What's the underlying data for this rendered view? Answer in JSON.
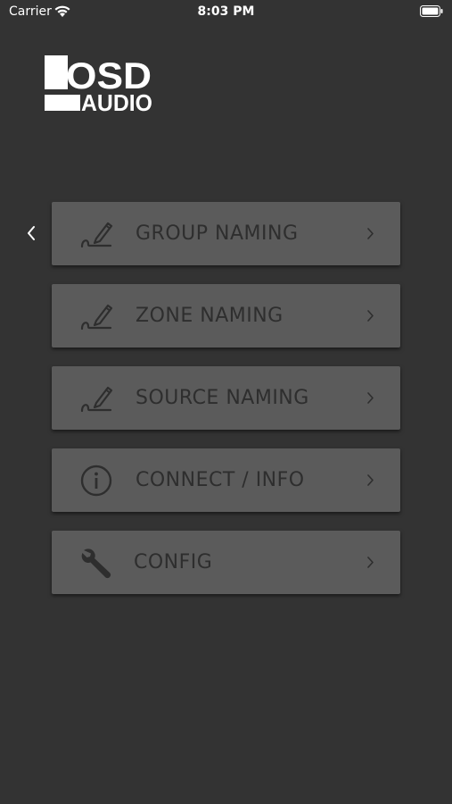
{
  "status_bar": {
    "carrier": "Carrier",
    "time": "8:03 PM"
  },
  "logo": {
    "line1": "OSD",
    "line2": "AUDIO"
  },
  "menu": {
    "items": [
      {
        "label": "GROUP NAMING",
        "icon": "pencil-edit-icon"
      },
      {
        "label": "ZONE NAMING",
        "icon": "pencil-edit-icon"
      },
      {
        "label": "SOURCE NAMING",
        "icon": "pencil-edit-icon"
      },
      {
        "label": "CONNECT / INFO",
        "icon": "info-icon"
      },
      {
        "label": "CONFIG",
        "icon": "wrench-icon"
      }
    ]
  },
  "colors": {
    "background": "#333333",
    "button": "#5b5b5b",
    "button_text": "#2e2e2e",
    "icon": "#2e2e2e"
  }
}
